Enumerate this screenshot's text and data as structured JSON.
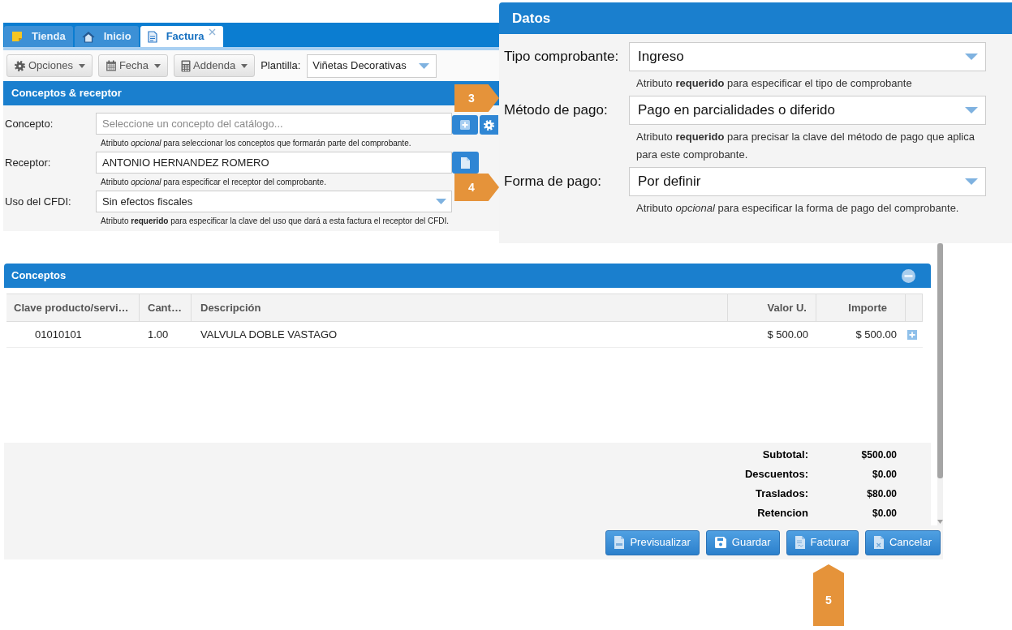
{
  "tabs": [
    {
      "label": "Tienda",
      "selected": false,
      "closable": false
    },
    {
      "label": "Inicio",
      "selected": false,
      "closable": false
    },
    {
      "label": "Factura",
      "selected": true,
      "closable": true
    }
  ],
  "toolbar": {
    "buttons": [
      {
        "label": "Opciones"
      },
      {
        "label": "Fecha"
      },
      {
        "label": "Addenda"
      }
    ],
    "template_label": "Plantilla:",
    "template_value": "Viñetas Decorativas"
  },
  "receptor_panel": {
    "title": "Conceptos & receptor",
    "fields": [
      {
        "kind": "search",
        "label": "Concepto:",
        "placeholder": "Seleccione un concepto del catálogo...",
        "hint": "Atributo *opcional* para seleccionar los conceptos que formarán parte del comprobante."
      },
      {
        "kind": "text",
        "label": "Receptor:",
        "value": "ANTONIO HERNANDEZ ROMERO",
        "hint": "Atributo *opcional* para especificar el receptor del comprobante."
      },
      {
        "kind": "select",
        "label": "Uso del CFDI:",
        "value": "Sin efectos fiscales",
        "hint": "Atributo **requerido** para especificar la clave del uso que dará a esta factura el receptor del CFDI."
      }
    ]
  },
  "datos_panel": {
    "title": "Datos",
    "fields": [
      {
        "label": "Tipo comprobante:",
        "value": "Ingreso",
        "hint": "Atributo **requerido** para especificar el tipo de comprobante"
      },
      {
        "label": "Método de pago:",
        "value": "Pago en parcialidades o diferido",
        "hint": "Atributo **requerido** para precisar la clave del método de pago que aplica para este comprobante."
      },
      {
        "label": "Forma de pago:",
        "value": "Por definir",
        "hint": "Atributo *opcional* para especificar la forma de pago del comprobante."
      }
    ]
  },
  "conceptos_panel": {
    "title": "Conceptos",
    "table": {
      "columns": [
        "Clave producto/servi…",
        "Cant…",
        "Descripción",
        "Valor U.",
        "Importe"
      ],
      "rows": [
        [
          "01010101",
          "1.00",
          "VALVULA DOBLE VASTAGO",
          "$ 500.00",
          "$ 500.00"
        ]
      ]
    },
    "totals": [
      {
        "label": "Subtotal:",
        "value": "$500.00"
      },
      {
        "label": "Descuentos:",
        "value": "$0.00"
      },
      {
        "label": "Traslados:",
        "value": "$80.00"
      },
      {
        "label": "Retencion",
        "value": "$0.00"
      }
    ]
  },
  "actions": [
    {
      "label": "Previsualizar"
    },
    {
      "label": "Guardar"
    },
    {
      "label": "Facturar"
    },
    {
      "label": "Cancelar"
    }
  ],
  "callouts": [
    {
      "number": "3",
      "kind": "right"
    },
    {
      "number": "4",
      "kind": "right"
    },
    {
      "number": "5",
      "kind": "up"
    }
  ]
}
